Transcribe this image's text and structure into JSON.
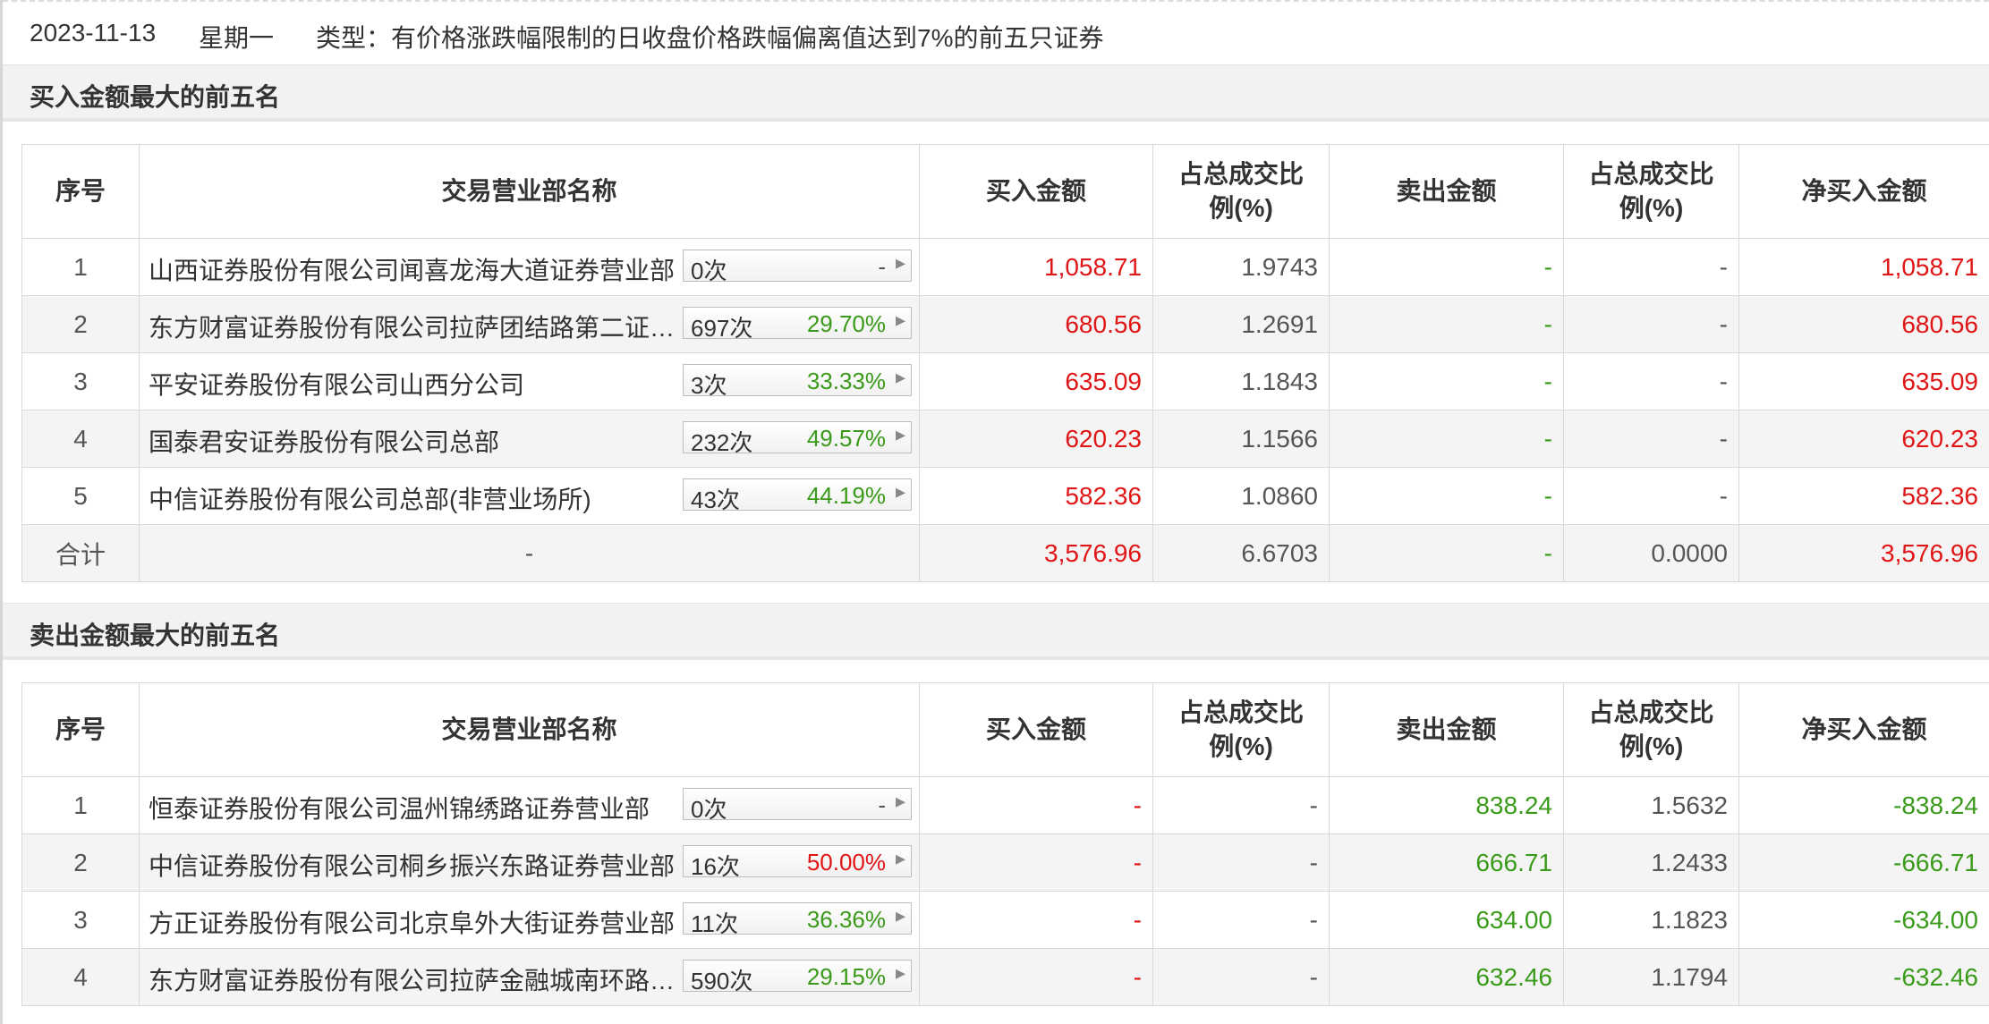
{
  "header": {
    "date": "2023-11-13",
    "weekday": "星期一",
    "type_text": "类型：有价格涨跌幅限制的日收盘价格跌幅偏离值达到7%的前五只证券"
  },
  "colors": {
    "up": "#e01515",
    "down": "#3a9a1a",
    "text": "#333333",
    "row_alt": "#f4f4f4"
  },
  "columns": {
    "seq": "序号",
    "dept": "交易营业部名称",
    "buy": "买入金额",
    "buy_ratio_l1": "占总成交比",
    "buy_ratio_l2": "例(%)",
    "sell": "卖出金额",
    "sell_ratio_l1": "占总成交比",
    "sell_ratio_l2": "例(%)",
    "net": "净买入金额"
  },
  "buy_section": {
    "title": "买入金额最大的前五名",
    "rows": [
      {
        "seq": "1",
        "dept": "山西证券股份有限公司闻喜龙海大道证券营业部",
        "count": "0次",
        "pct": "-",
        "buy": "1,058.71",
        "buy_ratio": "1.9743",
        "sell": "-",
        "sell_ratio": "-",
        "net": "1,058.71"
      },
      {
        "seq": "2",
        "dept": "东方财富证券股份有限公司拉萨团结路第二证券营业部",
        "count": "697次",
        "pct": "29.70%",
        "buy": "680.56",
        "buy_ratio": "1.2691",
        "sell": "-",
        "sell_ratio": "-",
        "net": "680.56"
      },
      {
        "seq": "3",
        "dept": "平安证券股份有限公司山西分公司",
        "count": "3次",
        "pct": "33.33%",
        "buy": "635.09",
        "buy_ratio": "1.1843",
        "sell": "-",
        "sell_ratio": "-",
        "net": "635.09"
      },
      {
        "seq": "4",
        "dept": "国泰君安证券股份有限公司总部",
        "count": "232次",
        "pct": "49.57%",
        "buy": "620.23",
        "buy_ratio": "1.1566",
        "sell": "-",
        "sell_ratio": "-",
        "net": "620.23"
      },
      {
        "seq": "5",
        "dept": "中信证券股份有限公司总部(非营业场所)",
        "count": "43次",
        "pct": "44.19%",
        "buy": "582.36",
        "buy_ratio": "1.0860",
        "sell": "-",
        "sell_ratio": "-",
        "net": "582.36"
      }
    ],
    "total": {
      "label": "合计",
      "dept": "-",
      "buy": "3,576.96",
      "buy_ratio": "6.6703",
      "sell": "-",
      "sell_ratio": "0.0000",
      "net": "3,576.96"
    }
  },
  "sell_section": {
    "title": "卖出金额最大的前五名",
    "rows": [
      {
        "seq": "1",
        "dept": "恒泰证券股份有限公司温州锦绣路证券营业部",
        "count": "0次",
        "pct": "-",
        "buy": "-",
        "buy_ratio": "-",
        "sell": "838.24",
        "sell_ratio": "1.5632",
        "net": "-838.24"
      },
      {
        "seq": "2",
        "dept": "中信证券股份有限公司桐乡振兴东路证券营业部",
        "count": "16次",
        "pct": "50.00%",
        "buy": "-",
        "buy_ratio": "-",
        "sell": "666.71",
        "sell_ratio": "1.2433",
        "net": "-666.71"
      },
      {
        "seq": "3",
        "dept": "方正证券股份有限公司北京阜外大街证券营业部",
        "count": "11次",
        "pct": "36.36%",
        "buy": "-",
        "buy_ratio": "-",
        "sell": "634.00",
        "sell_ratio": "1.1823",
        "net": "-634.00"
      },
      {
        "seq": "4",
        "dept": "东方财富证券股份有限公司拉萨金融城南环路证券营业部",
        "count": "590次",
        "pct": "29.15%",
        "buy": "-",
        "buy_ratio": "-",
        "sell": "632.46",
        "sell_ratio": "1.1794",
        "net": "-632.46"
      }
    ]
  },
  "icons": {
    "expand": "triangle-right-icon"
  }
}
